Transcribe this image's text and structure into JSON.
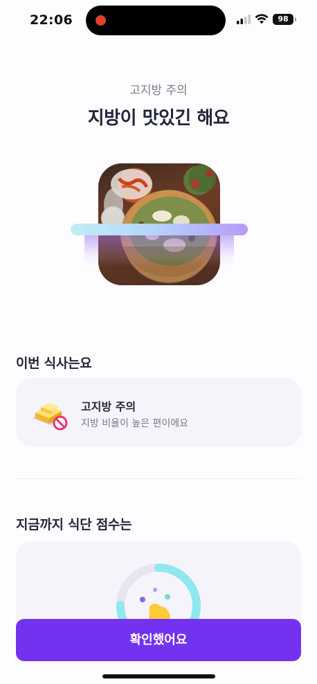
{
  "status_bar": {
    "time": "22:06",
    "battery": "98",
    "icons": [
      "recording-dot-icon",
      "cellular-signal-icon",
      "wifi-icon",
      "battery-icon"
    ]
  },
  "header": {
    "subtitle": "고지방 주의",
    "title": "지방이 맛있긴 해요"
  },
  "food_image": {
    "icon": "food-photo"
  },
  "meal_section": {
    "heading": "이번 식사는요",
    "card": {
      "icon": "butter-no-icon",
      "title": "고지방 주의",
      "description": "지방 비율이 높은 편이에요"
    }
  },
  "score_section": {
    "heading": "지금까지 식단 점수는"
  },
  "colors": {
    "accent": "#7331F0",
    "card_bg": "#F6F4FB",
    "ring": "#8EE8EE",
    "warning": "#E8356E"
  },
  "footer": {
    "confirm_label": "확인했어요"
  }
}
